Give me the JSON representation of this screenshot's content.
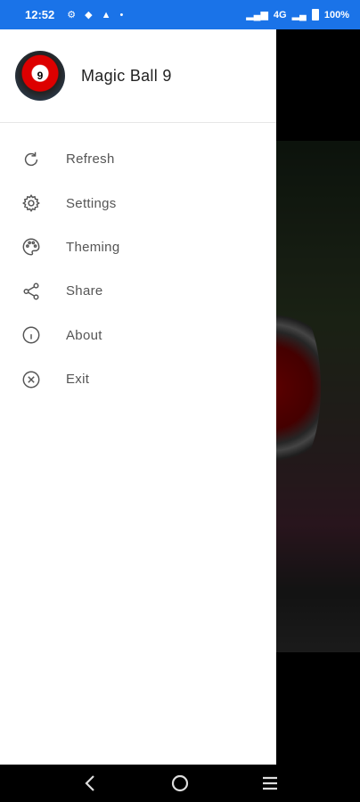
{
  "status_bar": {
    "time": "12:52",
    "network": "4G",
    "battery": "100%"
  },
  "drawer": {
    "app_name": "Magic Ball 9",
    "avatar_text": "9",
    "items": [
      {
        "label": "Refresh",
        "icon": "refresh-icon"
      },
      {
        "label": "Settings",
        "icon": "gear-icon"
      },
      {
        "label": "Theming",
        "icon": "palette-icon"
      },
      {
        "label": "Share",
        "icon": "share-icon"
      },
      {
        "label": "About",
        "icon": "info-icon"
      },
      {
        "label": "Exit",
        "icon": "close-circle-icon"
      }
    ]
  },
  "navigation": {
    "back": "back-icon",
    "home": "home-icon",
    "recents": "menu-icon"
  }
}
